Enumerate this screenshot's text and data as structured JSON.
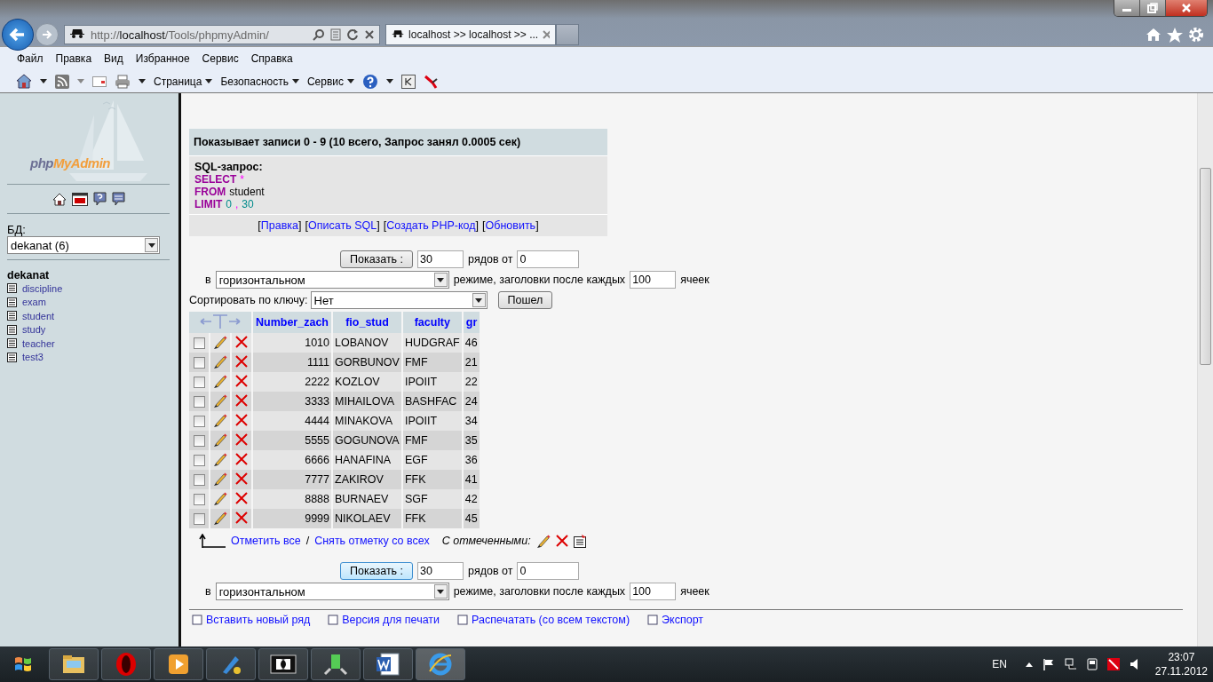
{
  "browser": {
    "address_host": "localhost",
    "address_prefix": "http://",
    "address_path": "/Tools/phpmyAdmin/",
    "tabs": [
      {
        "label": "localhost >> localhost >> ...",
        "selected": true
      }
    ],
    "menu": [
      "Файл",
      "Правка",
      "Вид",
      "Избранное",
      "Сервис",
      "Справка"
    ],
    "toolbar": [
      "Страница",
      "Безопасность",
      "Сервис"
    ]
  },
  "sidebar": {
    "logo_php": "php",
    "logo_rest": "MyAdmin",
    "db_label": "БД:",
    "db_select": "dekanat (6)",
    "db_name": "dekanat",
    "tables": [
      "discipline",
      "exam",
      "student",
      "study",
      "teacher",
      "test3"
    ]
  },
  "result": {
    "title": "Показывает записи 0 - 9 (10 всего, Запрос занял 0.0005 сек)",
    "sql_label": "SQL-запрос:",
    "sql_lines": [
      [
        {
          "text": "SELECT",
          "kind": "keyword"
        },
        {
          "text": "*",
          "kind": "operator"
        }
      ],
      [
        {
          "text": "FROM",
          "kind": "keyword"
        },
        {
          "text": "student",
          "kind": "name"
        }
      ],
      [
        {
          "text": "LIMIT",
          "kind": "keyword"
        },
        {
          "text": "0",
          "kind": "number"
        },
        {
          "text": ",",
          "kind": "operator"
        },
        {
          "text": "30",
          "kind": "number"
        }
      ]
    ],
    "links": [
      {
        "pre": "[",
        "label": "Правка",
        "post": "]"
      },
      {
        "pre": "[",
        "label": "Описать SQL",
        "post": "]"
      },
      {
        "pre": "[",
        "label": "Создать PHP-код",
        "post": "]"
      },
      {
        "pre": "[",
        "label": "Обновить",
        "post": "]"
      }
    ]
  },
  "nav_forms": [
    {
      "button": "Показать :",
      "focused": false,
      "rows": "30",
      "rows_label": "рядов от",
      "start": "0",
      "in_label": "в",
      "mode": "горизонтальном",
      "mode_label": "режиме, заголовки после каждых",
      "repeat": "100",
      "cells_label": "ячеек"
    },
    {
      "button": "Показать :",
      "focused": true,
      "rows": "30",
      "rows_label": "рядов от",
      "start": "0",
      "in_label": "в",
      "mode": "горизонтальном",
      "mode_label": "режиме, заголовки после каждых",
      "repeat": "100",
      "cells_label": "ячеек"
    }
  ],
  "sort": {
    "label": "Сортировать по ключу:",
    "value": "Нет",
    "button": "Пошел"
  },
  "table": {
    "columns": [
      "Number_zach",
      "fio_stud",
      "faculty",
      "gr"
    ],
    "rows": [
      {
        "checked": false,
        "cells": [
          "1010",
          "LOBANOV",
          "HUDGRAF",
          "46"
        ]
      },
      {
        "checked": false,
        "cells": [
          "1111",
          "GORBUNOV",
          "FMF",
          "21"
        ]
      },
      {
        "checked": false,
        "cells": [
          "2222",
          "KOZLOV",
          "IPOIIT",
          "22"
        ]
      },
      {
        "checked": false,
        "cells": [
          "3333",
          "MIHAILOVA",
          "BASHFAC",
          "24"
        ]
      },
      {
        "checked": false,
        "cells": [
          "4444",
          "MINAKOVA",
          "IPOIIT",
          "34"
        ]
      },
      {
        "checked": false,
        "cells": [
          "5555",
          "GOGUNOVA",
          "FMF",
          "35"
        ]
      },
      {
        "checked": false,
        "cells": [
          "6666",
          "HANAFINA",
          "EGF",
          "36"
        ]
      },
      {
        "checked": false,
        "cells": [
          "7777",
          "ZAKIROV",
          "FFK",
          "41"
        ]
      },
      {
        "checked": false,
        "cells": [
          "8888",
          "BURNAEV",
          "SGF",
          "42"
        ]
      },
      {
        "checked": false,
        "cells": [
          "9999",
          "NIKOLAEV",
          "FFK",
          "45"
        ]
      }
    ]
  },
  "selection": {
    "check_all": "Отметить все",
    "separator": "/",
    "uncheck_all": "Снять отметку со всех",
    "with_selected": "С отмеченными:"
  },
  "bottom_links": [
    "Вставить новый ряд",
    "Версия для печати",
    "Распечатать (со всем текстом)",
    "Экспорт"
  ],
  "taskbar": {
    "language": "EN",
    "time": "23:07",
    "date": "27.11.2012"
  }
}
